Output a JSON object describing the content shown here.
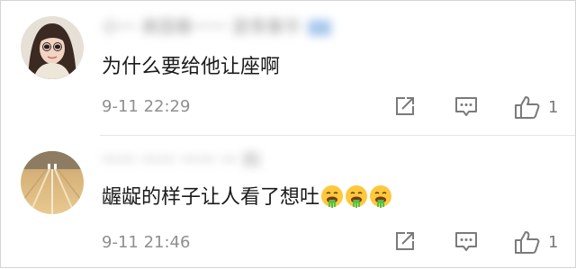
{
  "comments": [
    {
      "username": "小一 美国春一一 瑟青春华",
      "text": "为什么要给他让座啊",
      "time": "9-11 22:29",
      "likes": "1",
      "emojis": []
    },
    {
      "username": "一一 一一 一一 一 妈",
      "text": "龌龊的样子让人看了想吐",
      "time": "9-11 21:46",
      "likes": "1",
      "emojis": [
        "vomit-face-emoji",
        "vomit-face-emoji",
        "vomit-face-emoji"
      ]
    }
  ],
  "icons": {
    "share": "share-icon",
    "reply": "comment-icon",
    "like": "thumbs-up-icon"
  },
  "colors": {
    "text": "#1a1a1a",
    "meta": "#8f8f8f",
    "icon": "#7a7a7a"
  }
}
